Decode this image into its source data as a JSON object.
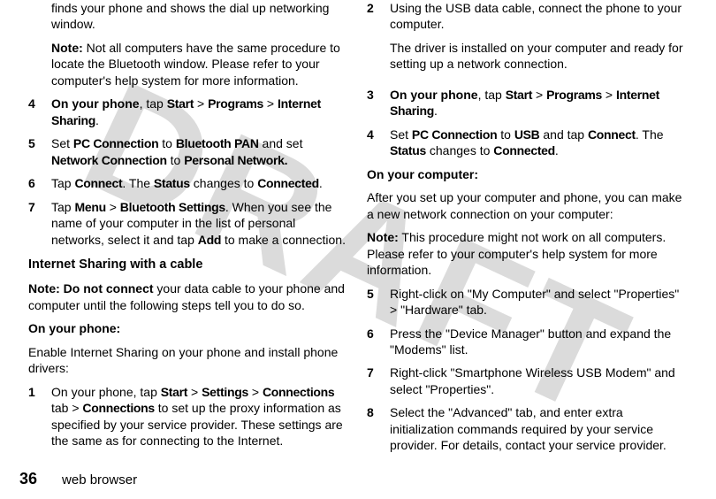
{
  "watermark": "DRAFT",
  "left": {
    "intro1": "finds your phone and shows the dial up networking window.",
    "note1_label": "Note:",
    "note1_body": " Not all computers have the same procedure to locate the Bluetooth window. Please refer to your computer's help system for more information.",
    "s4": {
      "num": "4",
      "lead": "On your phone",
      "mid": ", tap ",
      "a": "Start",
      "gt1": " > ",
      "b": "Programs",
      "gt2": " > ",
      "c": "Internet Sharing",
      "end": "."
    },
    "s5": {
      "num": "5",
      "t1": "Set ",
      "a": "PC Connection",
      "t2": " to ",
      "b": "Bluetooth PAN",
      "t3": " and set ",
      "c": "Network Connection",
      "t4": " to ",
      "d": "Personal Network.",
      "end": ""
    },
    "s6": {
      "num": "6",
      "t1": "Tap ",
      "a": "Connect",
      "t2": ". The ",
      "b": "Status",
      "t3": " changes to ",
      "c": "Connected",
      "end": "."
    },
    "s7": {
      "num": "7",
      "t1": "Tap ",
      "a": "Menu",
      "gt": " > ",
      "b": "Bluetooth Settings",
      "t2": ". When you see the name of your computer in the list of personal networks, select it and tap ",
      "c": "Add",
      "t3": " to make a connection."
    },
    "heading_cable": "Internet Sharing with a cable",
    "note2_label": "Note: Do not connect",
    "note2_body": " your data cable to your phone and computer until the following steps tell you to do so.",
    "onphone": "On your phone:",
    "enable": "Enable Internet Sharing on your phone and install phone drivers:",
    "s1": {
      "num": "1",
      "t1": "On your phone, tap ",
      "a": "Start",
      "gt1": " > ",
      "b": "Settings",
      "gt2": " > ",
      "c": "Connections",
      "t2": " tab > ",
      "d": "Connections",
      "t3": " to set up the proxy information as specified by your service provider. These settings are the same as for connecting to the Internet."
    }
  },
  "right": {
    "s2": {
      "num": "2",
      "t1": "Using the USB data cable, connect the phone to your computer.",
      "t2": "The driver is installed on your computer and ready for setting up a network connection."
    },
    "s3": {
      "num": "3",
      "lead": "On your phone",
      "mid": ", tap ",
      "a": "Start",
      "gt1": " > ",
      "b": "Programs",
      "gt2": " > ",
      "c": "Internet Sharing",
      "end": "."
    },
    "s4": {
      "num": "4",
      "t1": "Set ",
      "a": "PC Connection",
      "t2": " to ",
      "b": "USB",
      "t3": " and tap ",
      "c": "Connect",
      "t4": ". The ",
      "d": "Status",
      "t5": " changes to ",
      "e": "Connected",
      "end": "."
    },
    "oncomp": "On your computer:",
    "after": "After you set up your computer and phone, you can make a new network connection on your computer:",
    "note_label": "Note:",
    "note_body": " This procedure might not work on all computers. Please refer to your computer's help system for more information.",
    "s5": {
      "num": "5",
      "t": "Right-click on \"My Computer\" and select \"Properties\" > \"Hardware\" tab."
    },
    "s6": {
      "num": "6",
      "t": "Press the \"Device Manager\" button and expand the \"Modems\" list."
    },
    "s7": {
      "num": "7",
      "t": "Right-click \"Smartphone Wireless USB Modem\" and select \"Properties\"."
    },
    "s8": {
      "num": "8",
      "t": "Select the \"Advanced\" tab, and enter extra initialization commands required by your service provider. For details, contact your service provider."
    }
  },
  "footer": {
    "page": "36",
    "title": "web browser"
  }
}
